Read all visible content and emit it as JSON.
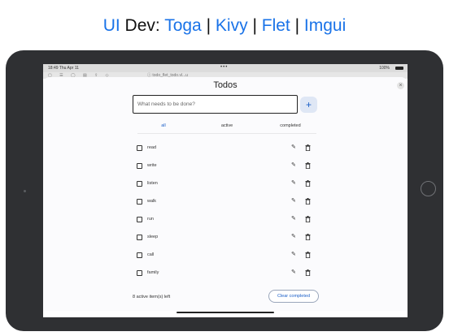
{
  "headline": {
    "part1": "UI",
    "part2": "Dev:",
    "part3": "Toga",
    "sep": "|",
    "part4": "Kivy",
    "part5": "Flet",
    "part6": "Imgui"
  },
  "status_bar": {
    "time": "18:49",
    "date": "Thu Apr 11",
    "battery": "100%"
  },
  "browser": {
    "url": "ⓘ todo_flet_todo.vl...u"
  },
  "app": {
    "title": "Todos",
    "new_task_placeholder": "What needs to be done?",
    "add_label": "+",
    "close_label": "×",
    "tabs": [
      "all",
      "active",
      "completed"
    ],
    "selected_tab": "all",
    "tasks": [
      {
        "label": "read",
        "done": false
      },
      {
        "label": "write",
        "done": false
      },
      {
        "label": "listen",
        "done": false
      },
      {
        "label": "walk",
        "done": false
      },
      {
        "label": "run",
        "done": false
      },
      {
        "label": "sleep",
        "done": false
      },
      {
        "label": "call",
        "done": false
      },
      {
        "label": "family",
        "done": false
      }
    ],
    "items_left": "8 active item(s) left",
    "clear_label": "Clear completed"
  },
  "colors": {
    "accent": "#1a5fc8",
    "headline_blue": "#1a73e8",
    "device": "#2f3033"
  },
  "icons": {
    "edit": "pencil-icon",
    "delete": "trash-icon",
    "add": "plus-icon",
    "close": "close-icon"
  }
}
